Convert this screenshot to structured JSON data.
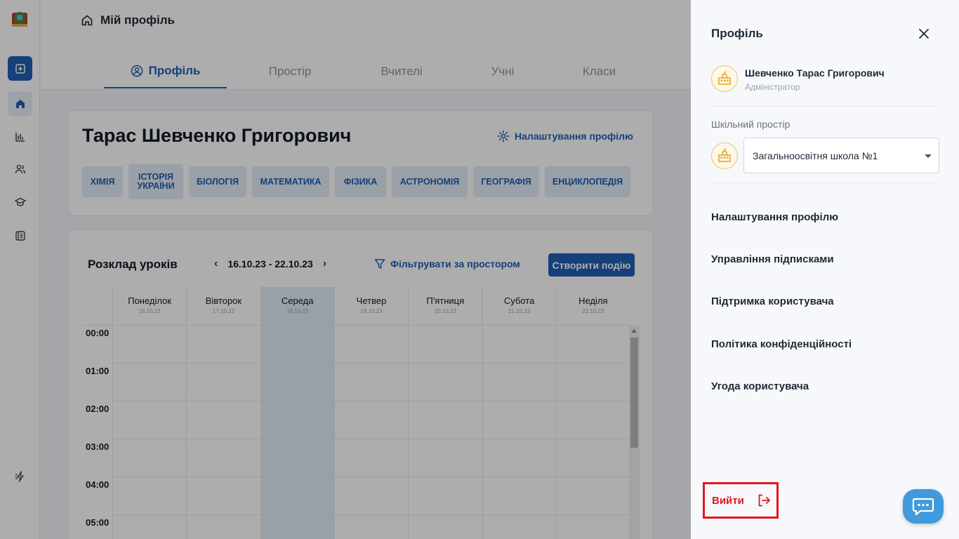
{
  "header": {
    "breadcrumb": "Мій профіль",
    "tabs": [
      {
        "label": "Профіль",
        "active": true
      },
      {
        "label": "Простір"
      },
      {
        "label": "Вчителі"
      },
      {
        "label": "Учні"
      },
      {
        "label": "Класи"
      }
    ]
  },
  "profile": {
    "name": "Тарас Шевченко Григорович",
    "settings_label": "Налаштування профілю",
    "subjects": [
      "Хімія",
      "Історія України",
      "Біологія",
      "Математика",
      "Фізика",
      "Астрономія",
      "Географія",
      "Енциклопедія"
    ]
  },
  "schedule": {
    "title": "Розклад уроків",
    "week_range": "16.10.23 - 22.10.23",
    "prev": "‹",
    "next": "›",
    "filter_label": "Фільтрувати за простором",
    "create_label": "Створити подію",
    "days": [
      {
        "name": "Понеділок",
        "date": "16.10.23"
      },
      {
        "name": "Вівторок",
        "date": "17.10.23"
      },
      {
        "name": "Середа",
        "date": "18.10.23",
        "today": true
      },
      {
        "name": "Четвер",
        "date": "19.10.23"
      },
      {
        "name": "П'ятниця",
        "date": "20.10.23"
      },
      {
        "name": "Субота",
        "date": "21.10.23"
      },
      {
        "name": "Неділя",
        "date": "22.10.23"
      }
    ],
    "hours": [
      "00:00",
      "01:00",
      "02:00",
      "03:00",
      "04:00",
      "05:00"
    ]
  },
  "drawer": {
    "title": "Профіль",
    "user_name": "Шевченко Тарас Григорович",
    "user_role": "Адміністратор",
    "space_label": "Шкільний простір",
    "space_value": "Загальноосвітня школа №1",
    "menu": [
      "Налаштування профілю",
      "Управління підписками",
      "Підтримка користувача",
      "Політика конфіденційності",
      "Угода користувача"
    ],
    "logout_label": "Вийти"
  },
  "colors": {
    "accent": "#1f5fb4",
    "danger": "#e3161c",
    "chat": "#3f9bdb",
    "today": "#e1ecf8"
  },
  "icons": {
    "rail": [
      "app-logo",
      "add-icon",
      "home-icon",
      "analytics-icon",
      "users-icon",
      "graduation-cap-icon",
      "journal-icon",
      "flash-icon"
    ],
    "drawer": [
      "close-icon",
      "school-icon",
      "logout-icon",
      "chat-icon"
    ]
  }
}
